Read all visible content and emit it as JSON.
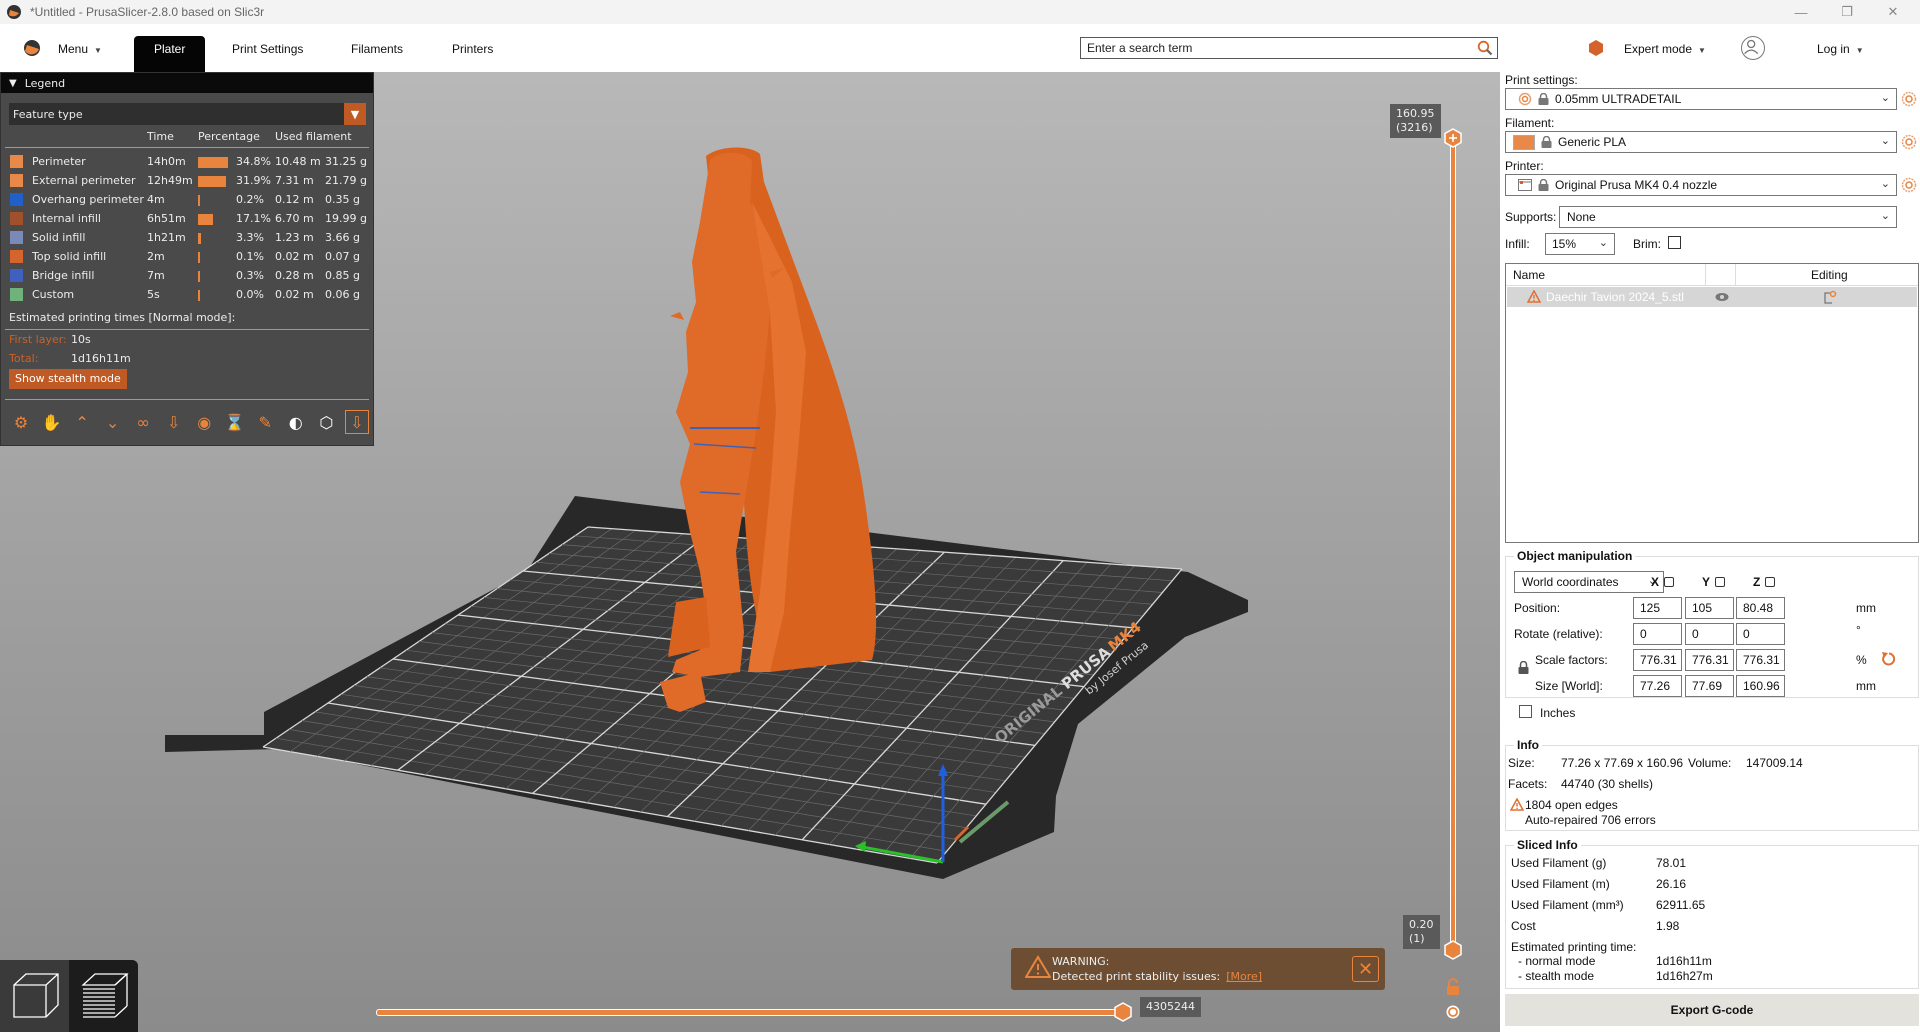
{
  "window": {
    "title": "*Untitled - PrusaSlicer-2.8.0 based on Slic3r",
    "controls": [
      "minimize",
      "maximize",
      "close"
    ]
  },
  "toolbar": {
    "menu_label": "Menu",
    "tabs": [
      {
        "label": "Plater",
        "active": true
      },
      {
        "label": "Print Settings",
        "active": false
      },
      {
        "label": "Filaments",
        "active": false
      },
      {
        "label": "Printers",
        "active": false
      }
    ],
    "search_placeholder": "Enter a search term",
    "mode_label": "Expert mode",
    "login_label": "Log in"
  },
  "legend": {
    "title": "Legend",
    "view_type": "Feature type",
    "columns": {
      "time": "Time",
      "percentage": "Percentage",
      "used_filament": "Used filament"
    },
    "rows": [
      {
        "name": "Perimeter",
        "color": "#E8894A",
        "time": "14h0m",
        "percent": 34.8,
        "percent_label": "34.8%",
        "length": "10.48 m",
        "weight": "31.25 g"
      },
      {
        "name": "External perimeter",
        "color": "#E8894A",
        "time": "12h49m",
        "percent": 31.9,
        "percent_label": "31.9%",
        "length": "7.31 m",
        "weight": "21.79 g"
      },
      {
        "name": "Overhang perimeter",
        "color": "#2060C8",
        "time": "4m",
        "percent": 0.2,
        "percent_label": "0.2%",
        "length": "0.12 m",
        "weight": "0.35 g"
      },
      {
        "name": "Internal infill",
        "color": "#A0502A",
        "time": "6h51m",
        "percent": 17.1,
        "percent_label": "17.1%",
        "length": "6.70 m",
        "weight": "19.99 g"
      },
      {
        "name": "Solid infill",
        "color": "#7A8AB8",
        "time": "1h21m",
        "percent": 3.3,
        "percent_label": "3.3%",
        "length": "1.23 m",
        "weight": "3.66 g"
      },
      {
        "name": "Top solid infill",
        "color": "#D6642E",
        "time": "2m",
        "percent": 0.1,
        "percent_label": "0.1%",
        "length": "0.02 m",
        "weight": "0.07 g"
      },
      {
        "name": "Bridge infill",
        "color": "#4060C0",
        "time": "7m",
        "percent": 0.3,
        "percent_label": "0.3%",
        "length": "0.28 m",
        "weight": "0.85 g"
      },
      {
        "name": "Custom",
        "color": "#6FB27A",
        "time": "5s",
        "percent": 0.0,
        "percent_label": "0.0%",
        "length": "0.02 m",
        "weight": "0.06 g"
      }
    ],
    "estimated_label": "Estimated printing times [Normal mode]:",
    "first_layer_label": "First layer:",
    "first_layer_value": "10s",
    "total_label": "Total:",
    "total_value": "1d16h11m",
    "stealth_button": "Show stealth mode",
    "visibility_icons": [
      "travel-icon",
      "wipe-icon",
      "retractions-icon",
      "deretractions-icon",
      "seams-icon",
      "tool-changes-icon",
      "color-changes-icon",
      "pause-icon",
      "custom-gcode-icon",
      "center-of-gravity-icon",
      "shells-icon",
      "tool-marker-icon"
    ]
  },
  "viewport": {
    "bed_brand": "ORIGINAL",
    "bed_brand2": "PRUSA",
    "bed_model": "MK4",
    "bed_byline": "by Josef Prusa",
    "vslider_top_value": "160.95",
    "vslider_top_layer": "(3216)",
    "vslider_bottom_value": "0.20",
    "vslider_bottom_layer": "(1)",
    "hslider_value": "4305244",
    "model_color": "#E06A28"
  },
  "warning": {
    "title": "WARNING:",
    "message": "Detected print stability issues:",
    "link": "[More]"
  },
  "panel": {
    "print_settings_label": "Print settings:",
    "print_settings_value": "0.05mm ULTRADETAIL",
    "filament_label": "Filament:",
    "filament_value": "Generic PLA",
    "filament_color": "#E8894A",
    "printer_label": "Printer:",
    "printer_value": "Original Prusa MK4 0.4 nozzle",
    "supports_label": "Supports:",
    "supports_value": "None",
    "infill_label": "Infill:",
    "infill_value": "15%",
    "brim_label": "Brim:",
    "brim_checked": false,
    "object_list": {
      "col_name": "Name",
      "col_editing": "Editing",
      "objects": [
        {
          "name": "Daechir Tavion 2024_5.stl",
          "warning": true
        }
      ]
    },
    "manipulation": {
      "title": "Object manipulation",
      "coord_system": "World coordinates",
      "axes": [
        "X",
        "Y",
        "Z"
      ],
      "position_label": "Position:",
      "position": [
        "125",
        "105",
        "80.48"
      ],
      "position_unit": "mm",
      "rotate_label": "Rotate (relative):",
      "rotate": [
        "0",
        "0",
        "0"
      ],
      "rotate_unit": "°",
      "scale_label": "Scale factors:",
      "scale": [
        "776.31",
        "776.31",
        "776.31"
      ],
      "scale_unit": "%",
      "size_label": "Size [World]:",
      "size": [
        "77.26",
        "77.69",
        "160.96"
      ],
      "size_unit": "mm",
      "inches_label": "Inches"
    },
    "info": {
      "title": "Info",
      "size_label": "Size:",
      "size_value": "77.26 x 77.69 x 160.96",
      "volume_label": "Volume:",
      "volume_value": "147009.14",
      "facets_label": "Facets:",
      "facets_value": "44740 (30 shells)",
      "open_edges": "1804 open edges",
      "auto_repaired": "Auto-repaired 706 errors"
    },
    "sliced_info": {
      "title": "Sliced Info",
      "rows": [
        {
          "label": "Used Filament (g)",
          "value": "78.01"
        },
        {
          "label": "Used Filament (m)",
          "value": "26.16"
        },
        {
          "label": "Used Filament (mm³)",
          "value": "62911.65"
        },
        {
          "label": "Cost",
          "value": "1.98"
        }
      ],
      "est_label": "Estimated printing time:",
      "normal_label": "- normal mode",
      "normal_value": "1d16h11m",
      "stealth_label": "- stealth mode",
      "stealth_value": "1d16h27m"
    },
    "export_button": "Export G-code"
  }
}
